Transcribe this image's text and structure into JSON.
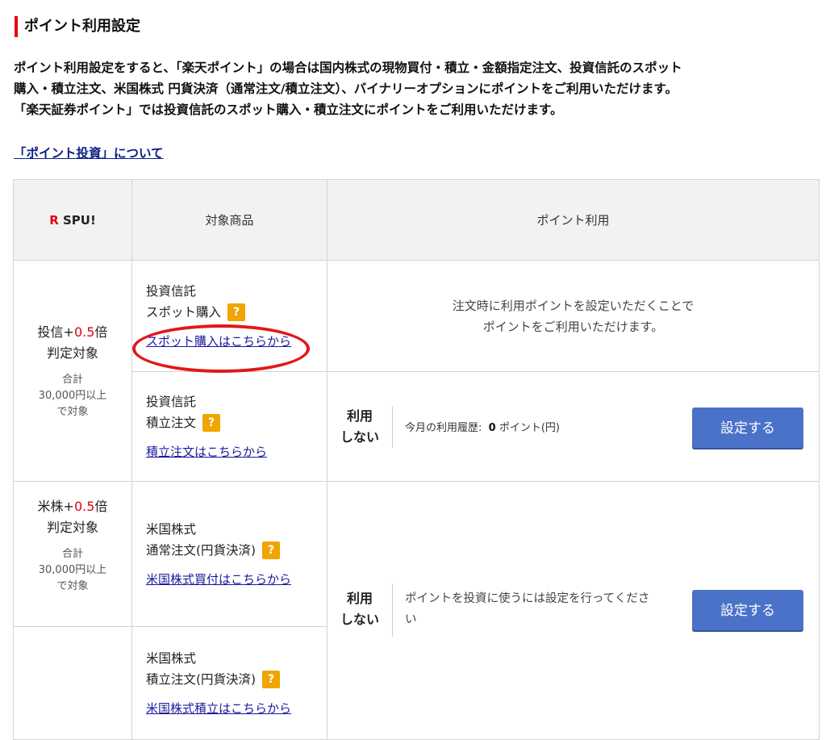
{
  "page": {
    "title": "ポイント利用設定",
    "intro_lines": [
      "ポイント利用設定をすると、「楽天ポイント」の場合は国内株式の現物買付・積立・金額指定注文、投資信託のスポット",
      "購入・積立注文、米国株式 円貨決済（通常注文/積立注文）、バイナリーオプションにポイントをご利用いただけます。",
      "「楽天証券ポイント」では投資信託のスポット購入・積立注文にポイントをご利用いただけます。"
    ],
    "about_link": "「ポイント投資」について"
  },
  "table": {
    "header": {
      "spu_r": "R",
      "spu_text": "SPU!",
      "col_product": "対象商品",
      "col_use": "ポイント利用"
    },
    "group1": {
      "mult_prefix": "投信+",
      "mult_value": "0.5",
      "mult_suffix": "倍",
      "mult_line2": "判定対象",
      "cond_lines": [
        "合計",
        "30,000円以上",
        "で対象"
      ]
    },
    "group2": {
      "mult_prefix": "米株+",
      "mult_value": "0.5",
      "mult_suffix": "倍",
      "mult_line2": "判定対象",
      "cond_lines": [
        "合計",
        "30,000円以上",
        "で対象"
      ]
    },
    "products": [
      {
        "line1": "投資信託",
        "line2": "スポット購入",
        "link": "スポット購入はこちらから"
      },
      {
        "line1": "投資信託",
        "line2": "積立注文",
        "link": "積立注文はこちらから"
      },
      {
        "line1": "米国株式",
        "line2": "通常注文(円貨決済)",
        "link": "米国株式買付はこちらから"
      },
      {
        "line1": "米国株式",
        "line2": "積立注文(円貨決済)",
        "link": "米国株式積立はこちらから"
      }
    ],
    "q_mark": "?",
    "spot_note": [
      "注文時に利用ポイントを設定いただくことで",
      "ポイントをご利用いただけます。"
    ],
    "use1": {
      "status_line1": "利用",
      "status_line2": "しない",
      "history_label": "今月の利用履歴:",
      "history_value": "0",
      "history_unit": "ポイント(円)",
      "button": "設定する"
    },
    "use2": {
      "status_line1": "利用",
      "status_line2": "しない",
      "message_line1": "ポイントを投資に使うには設定を行ってくださ",
      "message_line2": "い",
      "button": "設定する"
    }
  },
  "colors": {
    "accent_red": "#e60012",
    "button_blue": "#4a72c8",
    "help_orange": "#f0a500",
    "annotation_red": "#e21818"
  }
}
